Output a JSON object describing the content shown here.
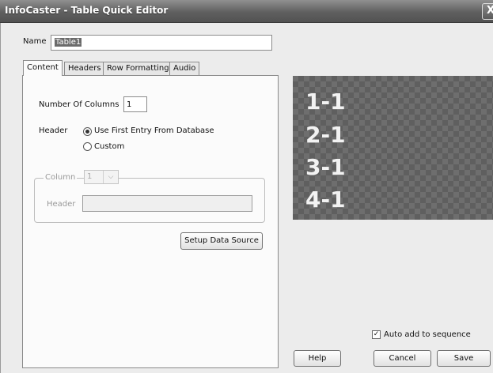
{
  "window": {
    "title": "InfoCaster - Table Quick Editor",
    "close_glyph": "X"
  },
  "name": {
    "label": "Name",
    "value": "Table1"
  },
  "tabs": [
    {
      "label": "Content",
      "active": true
    },
    {
      "label": "Headers",
      "active": false
    },
    {
      "label": "Row Formatting",
      "active": false
    },
    {
      "label": "Audio",
      "active": false
    }
  ],
  "content": {
    "num_columns_label": "Number Of Columns",
    "num_columns_value": "1",
    "header_label": "Header",
    "header_options": [
      {
        "label": "Use First Entry From Database",
        "selected": true
      },
      {
        "label": "Custom",
        "selected": false
      }
    ],
    "column_group": {
      "legend": "Column",
      "column_value": "1",
      "header_label": "Header",
      "header_value": ""
    },
    "setup_button": "Setup Data Source"
  },
  "preview": {
    "rows": [
      "1-1",
      "2-1",
      "3-1",
      "4-1"
    ]
  },
  "auto_add": {
    "label": "Auto add to sequence",
    "checked": true
  },
  "buttons": {
    "help": "Help",
    "cancel": "Cancel",
    "save": "Save"
  }
}
